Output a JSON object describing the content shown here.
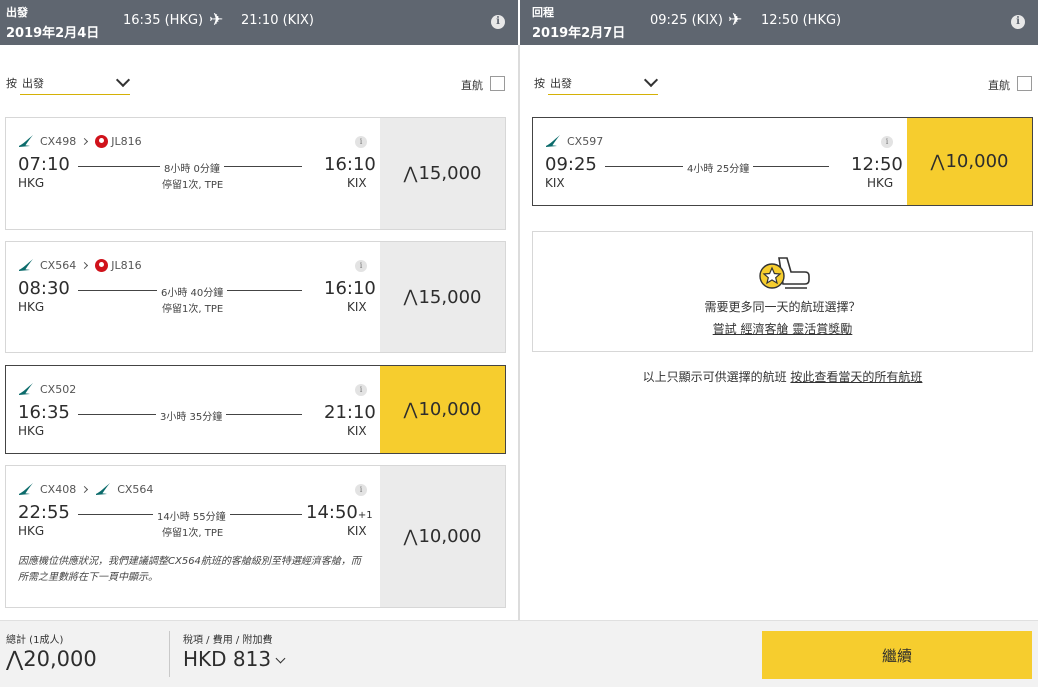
{
  "outbound": {
    "label": "出發",
    "date": "2019年2月4日",
    "dep": "16:35 (HKG)",
    "arr": "21:10 (KIX)",
    "sort_by": "按",
    "sort_value": "出發",
    "nonstop": "直航",
    "flights": [
      {
        "airline1": "CX498",
        "airline2": "JL816",
        "dep_time": "07:10",
        "dep_airport": "HKG",
        "duration": "8小時 0分鐘",
        "stop": "停留1次, TPE",
        "arr_time": "16:10",
        "arr_airport": "KIX",
        "price_symbol": "⋀",
        "price": "15,000"
      },
      {
        "airline1": "CX564",
        "airline2": "JL816",
        "dep_time": "08:30",
        "dep_airport": "HKG",
        "duration": "6小時 40分鐘",
        "stop": "停留1次, TPE",
        "arr_time": "16:10",
        "arr_airport": "KIX",
        "price_symbol": "⋀",
        "price": "15,000"
      },
      {
        "airline1": "CX502",
        "dep_time": "16:35",
        "dep_airport": "HKG",
        "duration": "3小時 35分鐘",
        "arr_time": "21:10",
        "arr_airport": "KIX",
        "price_symbol": "⋀",
        "price": "10,000"
      },
      {
        "airline1": "CX408",
        "airline2": "CX564",
        "dep_time": "22:55",
        "dep_airport": "HKG",
        "duration": "14小時 55分鐘",
        "stop": "停留1次, TPE",
        "arr_time": "14:50",
        "arr_plus": "+1",
        "arr_airport": "KIX",
        "price_symbol": "⋀",
        "price": "10,000",
        "note": "因應機位供應狀況，我們建議調整CX564航班的客艙級別至特選經濟客艙，而所需之里數將在下一頁中顯示。"
      }
    ]
  },
  "return": {
    "label": "回程",
    "date": "2019年2月7日",
    "dep": "09:25 (KIX)",
    "arr": "12:50 (HKG)",
    "sort_by": "按",
    "sort_value": "出發",
    "nonstop": "直航",
    "flight": {
      "airline1": "CX597",
      "dep_time": "09:25",
      "dep_airport": "KIX",
      "duration": "4小時 25分鐘",
      "arr_time": "12:50",
      "arr_airport": "HKG",
      "price_symbol": "⋀",
      "price": "10,000"
    },
    "promo_question": "需要更多同一天的航班選擇？",
    "promo_link1": "嘗試 經濟客艙 靈活賞獎勵",
    "only_text": "以上只顯示可供選擇的航班 ",
    "only_link": "按此查看當天的所有航班"
  },
  "info_glyph": "i",
  "footer": {
    "total_label": "總計 (1成人)",
    "total_symbol": "⋀",
    "total_value": "20,000",
    "tax_label": "稅項 / 費用 / 附加費",
    "tax_value": "HKD 813",
    "continue": "繼續"
  },
  "colors": {
    "header": "#5f6670",
    "accent": "#f6cd2e",
    "price_bg": "#ebebeb"
  }
}
